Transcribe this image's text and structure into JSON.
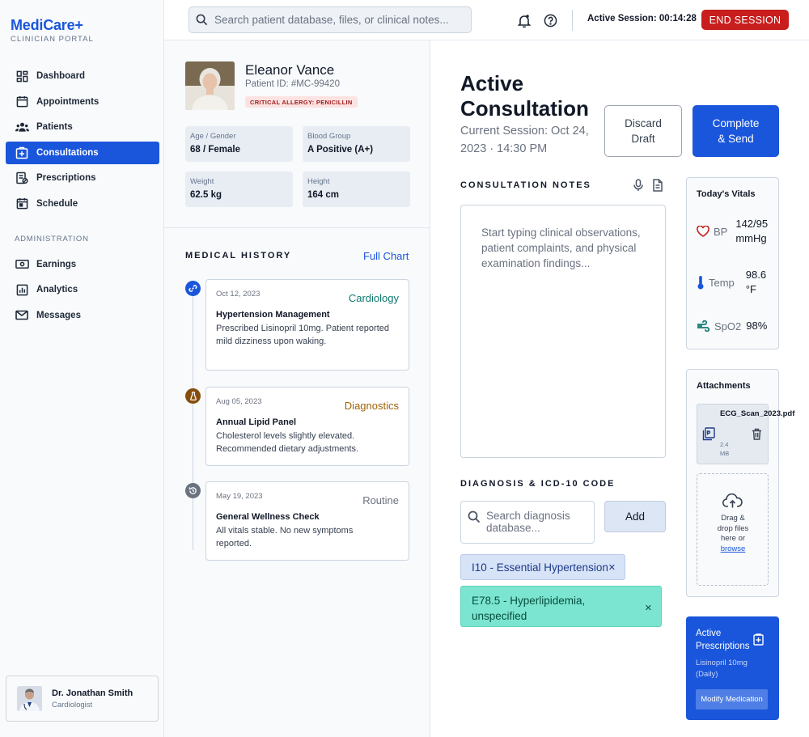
{
  "brand": {
    "name": "MediCare+",
    "subtitle": "CLINICIAN PORTAL"
  },
  "nav": {
    "items": [
      {
        "label": "Dashboard",
        "icon": "dashboard-icon"
      },
      {
        "label": "Appointments",
        "icon": "calendar-icon"
      },
      {
        "label": "Patients",
        "icon": "users-icon"
      },
      {
        "label": "Consultations",
        "icon": "medical-plus-icon",
        "active": true
      },
      {
        "label": "Prescriptions",
        "icon": "prescription-icon"
      },
      {
        "label": "Schedule",
        "icon": "schedule-icon"
      }
    ],
    "admin_title": "ADMINISTRATION",
    "admin_items": [
      {
        "label": "Earnings",
        "icon": "money-icon"
      },
      {
        "label": "Analytics",
        "icon": "analytics-icon"
      },
      {
        "label": "Messages",
        "icon": "mail-icon"
      }
    ]
  },
  "doctor": {
    "name": "Dr. Jonathan Smith",
    "role": "Cardiologist"
  },
  "topbar": {
    "search_placeholder": "Search patient database, files, or clinical notes...",
    "session_label": "Active Session: 00:14:28",
    "end_session": "END SESSION"
  },
  "patient": {
    "name": "Eleanor Vance",
    "id": "Patient ID: #MC-99420",
    "allergy": "CRITICAL ALLERGY: PENICILLIN",
    "stats": [
      {
        "label": "Age / Gender",
        "value": "68 / Female"
      },
      {
        "label": "Blood Group",
        "value": "A Positive (A+)"
      },
      {
        "label": "Weight",
        "value": "62.5 kg"
      },
      {
        "label": "Height",
        "value": "164 cm"
      }
    ]
  },
  "history": {
    "title": "MEDICAL HISTORY",
    "full_chart": "Full Chart",
    "entries": [
      {
        "date": "Oct 12, 2023",
        "tag": "Cardiology",
        "title": "Hypertension Management",
        "desc1": "Prescribed Lisinopril 10mg. Patient reported",
        "desc2": "mild dizziness upon waking.",
        "color": "#0f766e",
        "dot": "#1a56db"
      },
      {
        "date": "Aug 05, 2023",
        "tag": "Diagnostics",
        "title": "Annual Lipid Panel",
        "desc1": "Cholesterol levels slightly elevated.",
        "desc2": "Recommended dietary adjustments.",
        "color": "#a16207",
        "dot": "#854d0e"
      },
      {
        "date": "May 19, 2023",
        "tag": "Routine",
        "title": "General Wellness Check",
        "desc1": "All vitals stable. No new symptoms",
        "desc2": "reported.",
        "color": "#6b7280",
        "dot": "#6b7280"
      }
    ]
  },
  "consultation": {
    "title": "Active Consultation",
    "subtitle": "Current Session: Oct 24, 2023 · 14:30 PM",
    "discard": "Discard Draft",
    "complete": "Complete & Send",
    "notes_label": "CONSULTATION NOTES",
    "notes_placeholder": "Start typing clinical observations, patient complaints, and physical examination findings...",
    "diagnosis_label": "DIAGNOSIS & ICD-10 CODE",
    "diagnosis_placeholder": "Search diagnosis database...",
    "add": "Add",
    "diagnoses": [
      {
        "label": "I10 - Essential Hypertension"
      },
      {
        "label": "E78.5 - Hyperlipidemia, unspecified"
      }
    ],
    "remove_symbol": "✕"
  },
  "vitals": {
    "title": "Today's Vitals",
    "rows": [
      {
        "label": "BP",
        "value": "142/95 mmHg",
        "icon": "heart-icon",
        "color": "#c81e1e"
      },
      {
        "label": "Temp",
        "value": "98.6 °F",
        "icon": "thermometer-icon",
        "color": "#1a56db"
      },
      {
        "label": "SpO2",
        "value": "98%",
        "icon": "wind-icon",
        "color": "#0f766e"
      }
    ]
  },
  "attachments": {
    "title": "Attachments",
    "file_name": "ECG_Scan_2023.pdf",
    "file_size": "2.4 MB",
    "drop_text": "Drag & drop files here or",
    "browse": "browse"
  },
  "prescriptions": {
    "title": "Active Prescriptions",
    "med": "Lisinopril 10mg (Daily)",
    "modify": "Modify Medication"
  },
  "colors": {
    "primary": "#1a56db",
    "danger": "#c81e1e",
    "teal_chip": "#7be5d1"
  }
}
